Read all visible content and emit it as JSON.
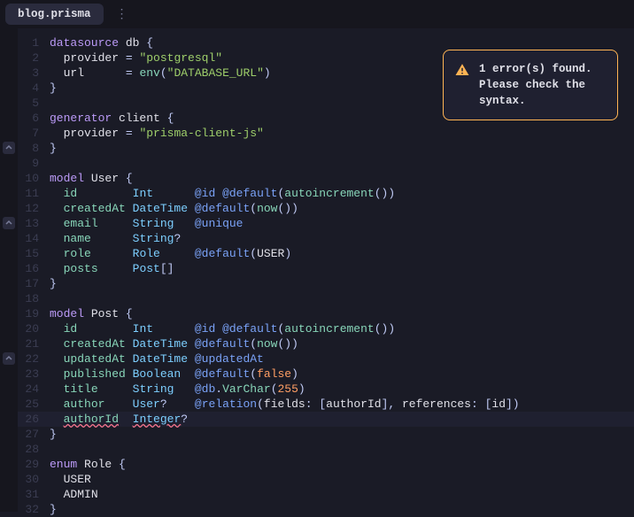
{
  "tab": {
    "filename": "blog.prisma"
  },
  "error": {
    "message": "1 error(s) found. Please check the syntax."
  },
  "highlighted_line": 26,
  "fold_markers": [
    8,
    13,
    22
  ],
  "lines": [
    {
      "n": 1,
      "tokens": [
        [
          "kw",
          "datasource"
        ],
        [
          "",
          ""
        ],
        [
          "ident",
          " db"
        ],
        [
          "punc",
          " {"
        ]
      ]
    },
    {
      "n": 2,
      "tokens": [
        [
          "",
          "  "
        ],
        [
          "ident",
          "provider"
        ],
        [
          "punc",
          " = "
        ],
        [
          "str",
          "\"postgresql\""
        ]
      ]
    },
    {
      "n": 3,
      "tokens": [
        [
          "",
          "  "
        ],
        [
          "ident",
          "url"
        ],
        [
          "",
          "      "
        ],
        [
          "punc",
          "= "
        ],
        [
          "func",
          "env"
        ],
        [
          "punc",
          "("
        ],
        [
          "str",
          "\"DATABASE_URL\""
        ],
        [
          "punc",
          ")"
        ]
      ]
    },
    {
      "n": 4,
      "tokens": [
        [
          "punc",
          "}"
        ]
      ]
    },
    {
      "n": 5,
      "tokens": []
    },
    {
      "n": 6,
      "tokens": [
        [
          "kw",
          "generator"
        ],
        [
          "ident",
          " client"
        ],
        [
          "punc",
          " {"
        ]
      ]
    },
    {
      "n": 7,
      "tokens": [
        [
          "",
          "  "
        ],
        [
          "ident",
          "provider"
        ],
        [
          "punc",
          " = "
        ],
        [
          "str",
          "\"prisma-client-js\""
        ]
      ]
    },
    {
      "n": 8,
      "tokens": [
        [
          "punc",
          "}"
        ]
      ]
    },
    {
      "n": 9,
      "tokens": []
    },
    {
      "n": 10,
      "tokens": [
        [
          "kw",
          "model"
        ],
        [
          "ident",
          " User"
        ],
        [
          "punc",
          " {"
        ]
      ]
    },
    {
      "n": 11,
      "tokens": [
        [
          "",
          "  "
        ],
        [
          "field",
          "id"
        ],
        [
          "",
          "        "
        ],
        [
          "type",
          "Int"
        ],
        [
          "",
          "      "
        ],
        [
          "attr",
          "@id"
        ],
        [
          "",
          ""
        ],
        [
          "attr",
          " @default"
        ],
        [
          "punc",
          "("
        ],
        [
          "func",
          "autoincrement"
        ],
        [
          "punc",
          "())"
        ]
      ]
    },
    {
      "n": 12,
      "tokens": [
        [
          "",
          "  "
        ],
        [
          "field",
          "createdAt"
        ],
        [
          "",
          ""
        ],
        [
          "type",
          " DateTime"
        ],
        [
          "",
          ""
        ],
        [
          "attr",
          " @default"
        ],
        [
          "punc",
          "("
        ],
        [
          "func",
          "now"
        ],
        [
          "punc",
          "())"
        ]
      ]
    },
    {
      "n": 13,
      "tokens": [
        [
          "",
          "  "
        ],
        [
          "field",
          "email"
        ],
        [
          "",
          "     "
        ],
        [
          "type",
          "String"
        ],
        [
          "",
          "   "
        ],
        [
          "attr",
          "@unique"
        ]
      ]
    },
    {
      "n": 14,
      "tokens": [
        [
          "",
          "  "
        ],
        [
          "field",
          "name"
        ],
        [
          "",
          "      "
        ],
        [
          "type",
          "String"
        ],
        [
          "punc",
          "?"
        ]
      ]
    },
    {
      "n": 15,
      "tokens": [
        [
          "",
          "  "
        ],
        [
          "field",
          "role"
        ],
        [
          "",
          "      "
        ],
        [
          "type",
          "Role"
        ],
        [
          "",
          "     "
        ],
        [
          "attr",
          "@default"
        ],
        [
          "punc",
          "("
        ],
        [
          "ident",
          "USER"
        ],
        [
          "punc",
          ")"
        ]
      ]
    },
    {
      "n": 16,
      "tokens": [
        [
          "",
          "  "
        ],
        [
          "field",
          "posts"
        ],
        [
          "",
          "     "
        ],
        [
          "type",
          "Post"
        ],
        [
          "punc",
          "[]"
        ]
      ]
    },
    {
      "n": 17,
      "tokens": [
        [
          "punc",
          "}"
        ]
      ]
    },
    {
      "n": 18,
      "tokens": []
    },
    {
      "n": 19,
      "tokens": [
        [
          "kw",
          "model"
        ],
        [
          "ident",
          " Post"
        ],
        [
          "punc",
          " {"
        ]
      ]
    },
    {
      "n": 20,
      "tokens": [
        [
          "",
          "  "
        ],
        [
          "field",
          "id"
        ],
        [
          "",
          "        "
        ],
        [
          "type",
          "Int"
        ],
        [
          "",
          "      "
        ],
        [
          "attr",
          "@id"
        ],
        [
          "attr",
          " @default"
        ],
        [
          "punc",
          "("
        ],
        [
          "func",
          "autoincrement"
        ],
        [
          "punc",
          "())"
        ]
      ]
    },
    {
      "n": 21,
      "tokens": [
        [
          "",
          "  "
        ],
        [
          "field",
          "createdAt"
        ],
        [
          "",
          ""
        ],
        [
          "type",
          " DateTime"
        ],
        [
          "attr",
          " @default"
        ],
        [
          "punc",
          "("
        ],
        [
          "func",
          "now"
        ],
        [
          "punc",
          "())"
        ]
      ]
    },
    {
      "n": 22,
      "tokens": [
        [
          "",
          "  "
        ],
        [
          "field",
          "updatedAt"
        ],
        [
          "",
          ""
        ],
        [
          "type",
          " DateTime"
        ],
        [
          "attr",
          " @updatedAt"
        ]
      ]
    },
    {
      "n": 23,
      "tokens": [
        [
          "",
          "  "
        ],
        [
          "field",
          "published"
        ],
        [
          "",
          ""
        ],
        [
          "type",
          " Boolean"
        ],
        [
          "",
          "  "
        ],
        [
          "attr",
          "@default"
        ],
        [
          "punc",
          "("
        ],
        [
          "bool",
          "false"
        ],
        [
          "punc",
          ")"
        ]
      ]
    },
    {
      "n": 24,
      "tokens": [
        [
          "",
          "  "
        ],
        [
          "field",
          "title"
        ],
        [
          "",
          "     "
        ],
        [
          "type",
          "String"
        ],
        [
          "",
          "   "
        ],
        [
          "attr",
          "@db"
        ],
        [
          "punc",
          "."
        ],
        [
          "func",
          "VarChar"
        ],
        [
          "punc",
          "("
        ],
        [
          "num",
          "255"
        ],
        [
          "punc",
          ")"
        ]
      ]
    },
    {
      "n": 25,
      "tokens": [
        [
          "",
          "  "
        ],
        [
          "field",
          "author"
        ],
        [
          "",
          "    "
        ],
        [
          "type",
          "User"
        ],
        [
          "punc",
          "?"
        ],
        [
          "",
          "    "
        ],
        [
          "attr",
          "@relation"
        ],
        [
          "punc",
          "("
        ],
        [
          "ident",
          "fields"
        ],
        [
          "punc",
          ": ["
        ],
        [
          "ident",
          "authorId"
        ],
        [
          "punc",
          "], "
        ],
        [
          "ident",
          "references"
        ],
        [
          "punc",
          ": ["
        ],
        [
          "ident",
          "id"
        ],
        [
          "punc",
          "])"
        ]
      ]
    },
    {
      "n": 26,
      "tokens": [
        [
          "",
          "  "
        ],
        [
          "field err",
          "authorId"
        ],
        [
          "",
          "  "
        ],
        [
          "type err",
          "Integer"
        ],
        [
          "punc",
          "?"
        ]
      ]
    },
    {
      "n": 27,
      "tokens": [
        [
          "punc",
          "}"
        ]
      ]
    },
    {
      "n": 28,
      "tokens": []
    },
    {
      "n": 29,
      "tokens": [
        [
          "kw",
          "enum"
        ],
        [
          "ident",
          " Role"
        ],
        [
          "punc",
          " {"
        ]
      ]
    },
    {
      "n": 30,
      "tokens": [
        [
          "",
          "  "
        ],
        [
          "ident",
          "USER"
        ]
      ]
    },
    {
      "n": 31,
      "tokens": [
        [
          "",
          "  "
        ],
        [
          "ident",
          "ADMIN"
        ]
      ]
    },
    {
      "n": 32,
      "tokens": [
        [
          "punc",
          "}"
        ]
      ]
    }
  ]
}
